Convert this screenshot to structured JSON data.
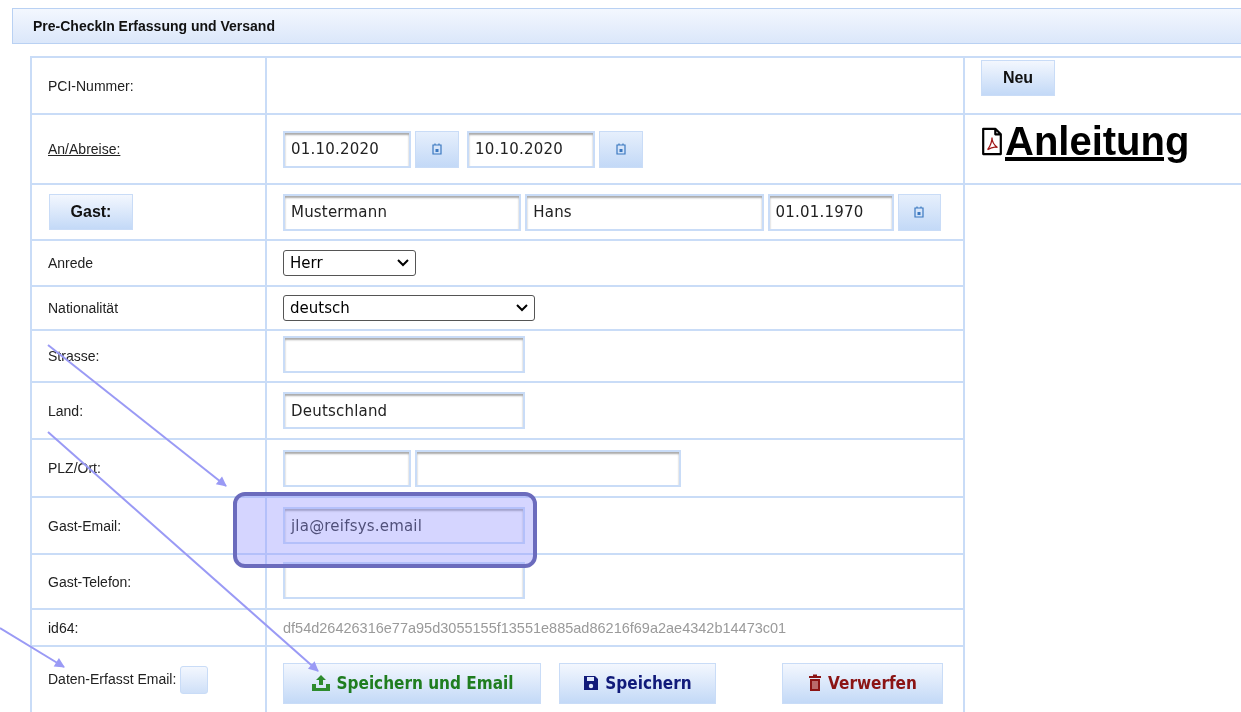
{
  "panel": {
    "title": "Pre-CheckIn Erfassung und Versand"
  },
  "rows": [
    {
      "kind": "text",
      "label": "PCI-Nummer:"
    },
    {
      "kind": "dates",
      "label": "An/Abreise:",
      "from": "01.10.2020",
      "to": "10.10.2020"
    },
    {
      "kind": "guest",
      "button": "Gast:",
      "last_name": "Mustermann",
      "first_name": "Hans",
      "birth_date": "01.01.1970"
    },
    {
      "kind": "salutation",
      "label": "Anrede",
      "value": "Herr"
    },
    {
      "kind": "nationality",
      "label": "Nationalität",
      "value": "deutsch"
    },
    {
      "kind": "input",
      "label": "Strasse:",
      "highlighted": false
    },
    {
      "kind": "input",
      "label": "Land:",
      "value": "Deutschland",
      "highlighted": false
    },
    {
      "kind": "zip",
      "label": "PLZ/Ort:"
    },
    {
      "kind": "input",
      "label": "Gast-Email:",
      "value": "jla@reifsys.email",
      "highlighted": true
    },
    {
      "kind": "input",
      "label": "Gast-Telefon:",
      "highlighted": false
    },
    {
      "kind": "readonly",
      "label": "id64:",
      "value": "df54d26426316e77a95d3055155f13551e885ad86216f69a2ae4342b14473c01"
    },
    {
      "kind": "actions",
      "label": "Daten-Erfasst Email:",
      "checked": false,
      "buttons": [
        {
          "kind": "send",
          "label": "Speichern und Email"
        },
        {
          "kind": "save",
          "label": "Speichern"
        },
        {
          "kind": "discard",
          "label": "Verwerfen"
        }
      ]
    }
  ],
  "side": {
    "new_button": "Neu",
    "manual_link": "Anleitung"
  }
}
